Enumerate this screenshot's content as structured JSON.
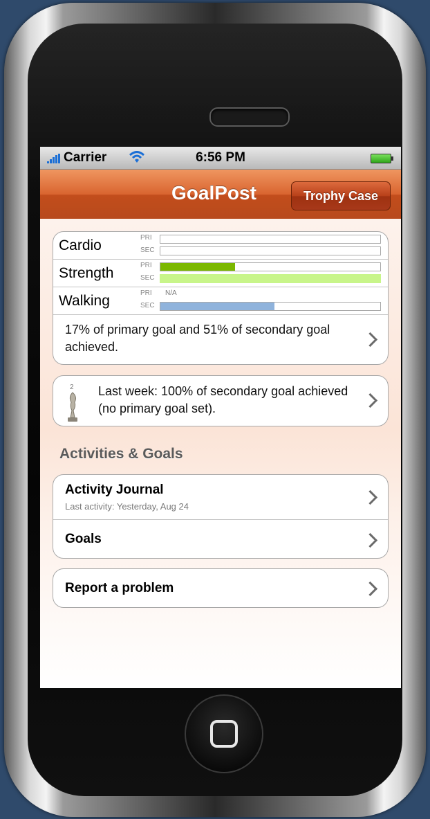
{
  "status_bar": {
    "carrier": "Carrier",
    "time": "6:56 PM",
    "signal_icon": "signal-bars-icon",
    "wifi_icon": "wifi-icon",
    "battery_icon": "battery-icon"
  },
  "nav": {
    "title": "GoalPost",
    "right_button": "Trophy Case"
  },
  "progress": {
    "pri_label": "PRI",
    "sec_label": "SEC",
    "na_label": "N/A",
    "rows": [
      {
        "name": "Cardio",
        "primary": 0,
        "secondary": 0,
        "primary_na": false
      },
      {
        "name": "Strength",
        "primary": 0.34,
        "secondary": 1.0,
        "primary_na": false
      },
      {
        "name": "Walking",
        "primary": 0,
        "secondary": 0.52,
        "primary_na": true
      }
    ],
    "summary": "17% of primary goal and 51% of secondary goal achieved."
  },
  "last_week": {
    "text": "Last week: 100% of secondary goal achieved (no primary goal set).",
    "icon": "trophy-icon"
  },
  "activities": {
    "section_title": "Activities & Goals",
    "journal_title": "Activity Journal",
    "journal_sub": "Last activity: Yesterday, Aug 24",
    "goals_title": "Goals"
  },
  "support": {
    "report_title": "Report a problem"
  },
  "colors": {
    "nav_orange": "#d96530",
    "primary_bar": "#7bb800",
    "secondary_bar_strength": "#c8f58a",
    "secondary_bar_walking": "#8fb3dc"
  }
}
